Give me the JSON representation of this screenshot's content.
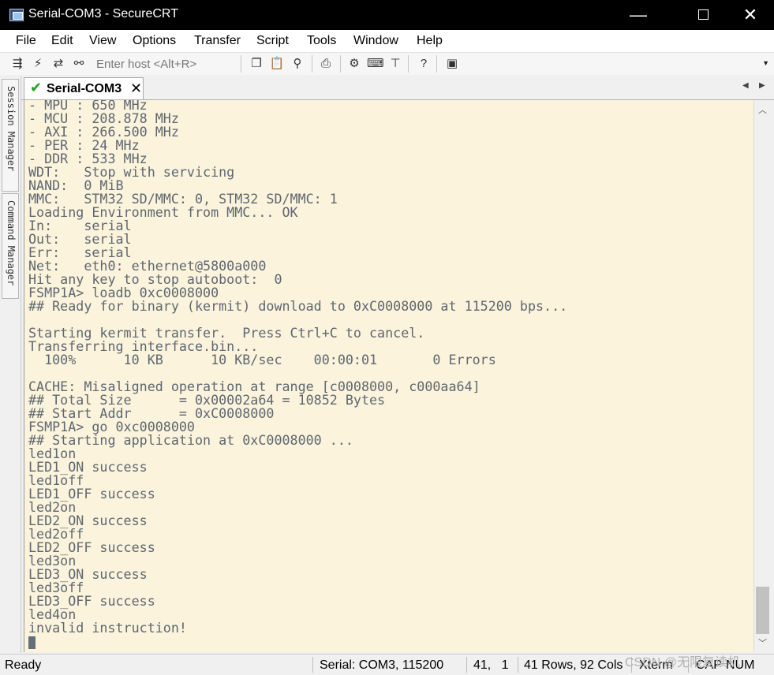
{
  "window": {
    "title": "Serial-COM3 - SecureCRT",
    "min_glyph": "—",
    "close_glyph": "✕"
  },
  "menu": [
    "File",
    "Edit",
    "View",
    "Options",
    "Transfer",
    "Script",
    "Tools",
    "Window",
    "Help"
  ],
  "toolbar": {
    "host_placeholder": "Enter host <Alt+R>",
    "icons": [
      "connect-icon",
      "lightning-icon",
      "reconnect-icon",
      "disconnect-icon",
      "copy-icon",
      "paste-icon",
      "find-icon",
      "print-icon",
      "settings-icon",
      "keymap-icon",
      "sftp-icon",
      "help-icon",
      "screen-icon"
    ]
  },
  "siderail": {
    "tabs": [
      "Session Manager",
      "Command Manager"
    ]
  },
  "tab": {
    "label": "Serial-COM3",
    "close_glyph": "✕",
    "check_glyph": "✔"
  },
  "terminal": {
    "lines": [
      "- MPU : 650 MHz",
      "- MCU : 208.878 MHz",
      "- AXI : 266.500 MHz",
      "- PER : 24 MHz",
      "- DDR : 533 MHz",
      "WDT:   Stop with servicing",
      "NAND:  0 MiB",
      "MMC:   STM32 SD/MMC: 0, STM32 SD/MMC: 1",
      "Loading Environment from MMC... OK",
      "In:    serial",
      "Out:   serial",
      "Err:   serial",
      "Net:   eth0: ethernet@5800a000",
      "Hit any key to stop autoboot:  0",
      "FSMP1A> loadb 0xc0008000",
      "## Ready for binary (kermit) download to 0xC0008000 at 115200 bps...",
      "",
      "Starting kermit transfer.  Press Ctrl+C to cancel.",
      "Transferring interface.bin...",
      "  100%      10 KB      10 KB/sec    00:00:01       0 Errors",
      "",
      "CACHE: Misaligned operation at range [c0008000, c000aa64]",
      "## Total Size      = 0x00002a64 = 10852 Bytes",
      "## Start Addr      = 0xC0008000",
      "FSMP1A> go 0xc0008000",
      "## Starting application at 0xC0008000 ...",
      "led1on",
      "LED1_ON success",
      "led1off",
      "LED1_OFF success",
      "led2on",
      "LED2_ON success",
      "led2off",
      "LED2_OFF success",
      "led3on",
      "LED3_ON success",
      "led3off",
      "LED3_OFF success",
      "led4on",
      "invalid instruction!"
    ],
    "text_color": "#5e6770",
    "background": "#fbf3dc"
  },
  "status": {
    "ready": "Ready",
    "connection": "Serial: COM3, 115200",
    "position": "41,   1",
    "size": "41 Rows, 92 Cols",
    "emulation": "Xterm",
    "cap": "CAP",
    "num": "NUM"
  },
  "watermark": "CSDN @无限复读机"
}
